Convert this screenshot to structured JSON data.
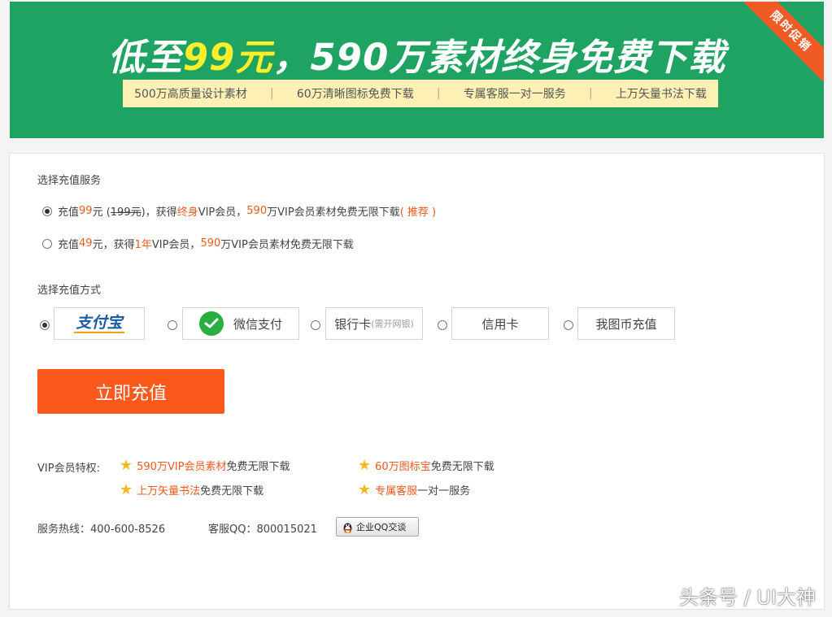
{
  "banner": {
    "title_pre": "低至",
    "title_highlight": "99元",
    "title_post": "，590万素材终身免费下载",
    "features": [
      "500万高质量设计素材",
      "60万清晰图标免费下载",
      "专属客服一对一服务",
      "上万矢量书法下载"
    ],
    "separator": "|",
    "ribbon": "限时促销",
    "colors": {
      "background": "#1fa362",
      "highlight": "#ffef2a",
      "ribbon": "#f05a24"
    }
  },
  "service": {
    "label": "选择充值服务",
    "option1": {
      "selected": true,
      "prefix": "充值 ",
      "price": "99",
      "unit": " 元 (",
      "orig_price": "199元",
      "mid": ")，获得 ",
      "term": "终身",
      "mid2": " VIP会员，",
      "count": "590",
      "suffix": " 万VIP会员素材免费无限下载",
      "recommend": "( 推荐 )"
    },
    "option2": {
      "selected": false,
      "prefix": "充值 ",
      "price": "49",
      "unit": " 元，获得 ",
      "term": "1年",
      "mid2": " VIP会员，",
      "count": "590",
      "suffix": " 万VIP会员素材免费无限下载"
    }
  },
  "payment": {
    "label": "选择充值方式",
    "alipay": {
      "logo_text": "支付宝",
      "selected": true
    },
    "wechat": {
      "label": "微信支付",
      "icon": "wechat-icon"
    },
    "bank": {
      "label": "银行卡",
      "note": "(需开网银)"
    },
    "credit": {
      "label": "信用卡"
    },
    "coin": {
      "label": "我图币充值"
    }
  },
  "submit_label": "立即充值",
  "privileges": {
    "label": "VIP会员特权:",
    "items": [
      {
        "highlight": "590万VIP会员素材",
        "rest": "免费无限下载"
      },
      {
        "highlight": "60万图标宝",
        "rest": "免费无限下载"
      },
      {
        "highlight": "上万矢量书法",
        "rest": "免费无限下载"
      },
      {
        "highlight": "专属客服",
        "rest": "一对一服务"
      }
    ],
    "icon": "star-icon"
  },
  "contact": {
    "hotline": "服务热线：400-600-8526",
    "qq": "客服QQ：800015021",
    "qq_button": "企业QQ交谈"
  },
  "watermark": "头条号 / UI大神",
  "accent_color": "#fc5a1d"
}
